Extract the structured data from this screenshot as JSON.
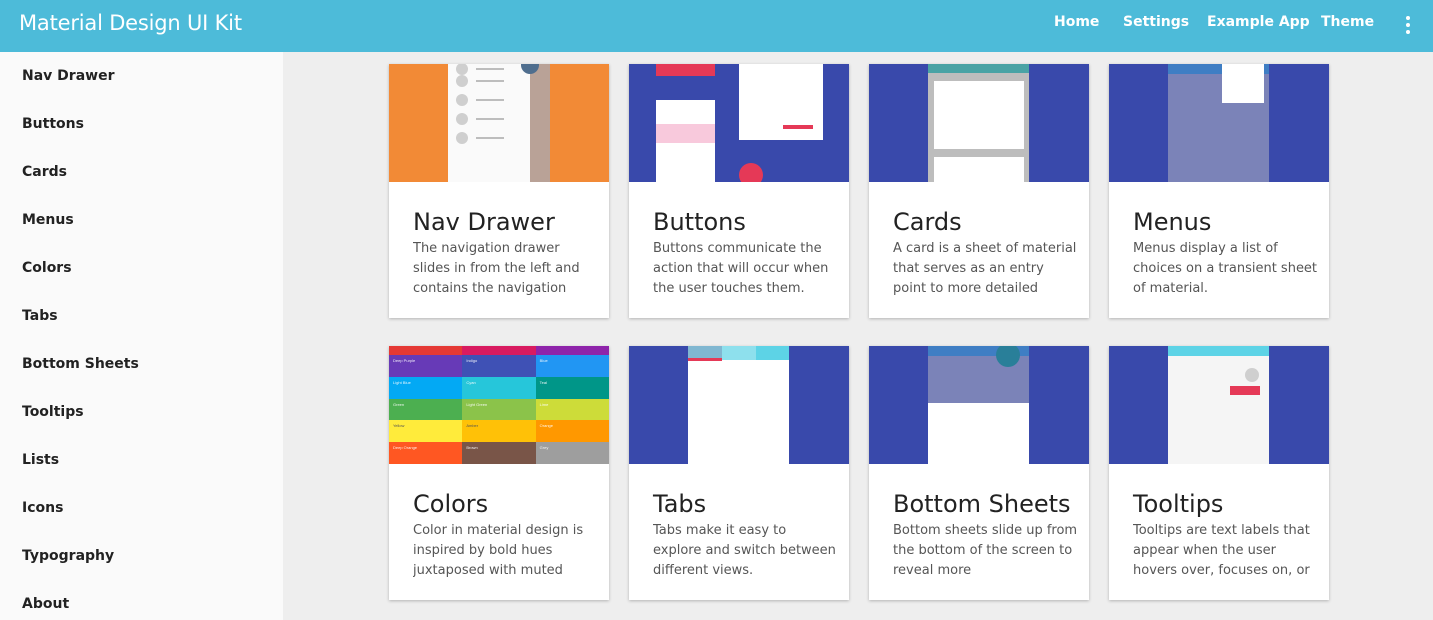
{
  "app": {
    "title": "Material Design UI Kit",
    "nav": [
      "Home",
      "Settings",
      "Example App",
      "Theme"
    ],
    "colors": {
      "appbar": "#4dbbd9",
      "indigo": "#3949ab",
      "accent": "#e53957",
      "orange": "#f28a36"
    }
  },
  "sidebar": {
    "items": [
      "Nav Drawer",
      "Buttons",
      "Cards",
      "Menus",
      "Colors",
      "Tabs",
      "Bottom Sheets",
      "Tooltips",
      "Lists",
      "Icons",
      "Typography",
      "About"
    ]
  },
  "cards": [
    {
      "title": "Nav Drawer",
      "desc": "The navigation drawer slides in from the left and contains the navigation"
    },
    {
      "title": "Buttons",
      "desc": "Buttons communicate the action that will occur when the user touches them."
    },
    {
      "title": "Cards",
      "desc": "A card is a sheet of material that serves as an entry point to more detailed"
    },
    {
      "title": "Menus",
      "desc": "Menus display a list of choices on a transient sheet of material."
    },
    {
      "title": "Colors",
      "desc": "Color in material design is inspired by bold hues juxtaposed with muted"
    },
    {
      "title": "Tabs",
      "desc": "Tabs make it easy to explore and switch between different views."
    },
    {
      "title": "Bottom Sheets",
      "desc": "Bottom sheets slide up from the bottom of the screen to reveal more"
    },
    {
      "title": "Tooltips",
      "desc": "Tooltips are text labels that appear when the user hovers over, focuses on, or"
    }
  ],
  "swatches": [
    "Deep Purple",
    "Indigo",
    "Blue",
    "Light Blue",
    "Cyan",
    "Teal",
    "Green",
    "Light Green",
    "Lime",
    "Yellow",
    "Amber",
    "Orange",
    "Deep Orange",
    "Brown",
    "Grey"
  ]
}
